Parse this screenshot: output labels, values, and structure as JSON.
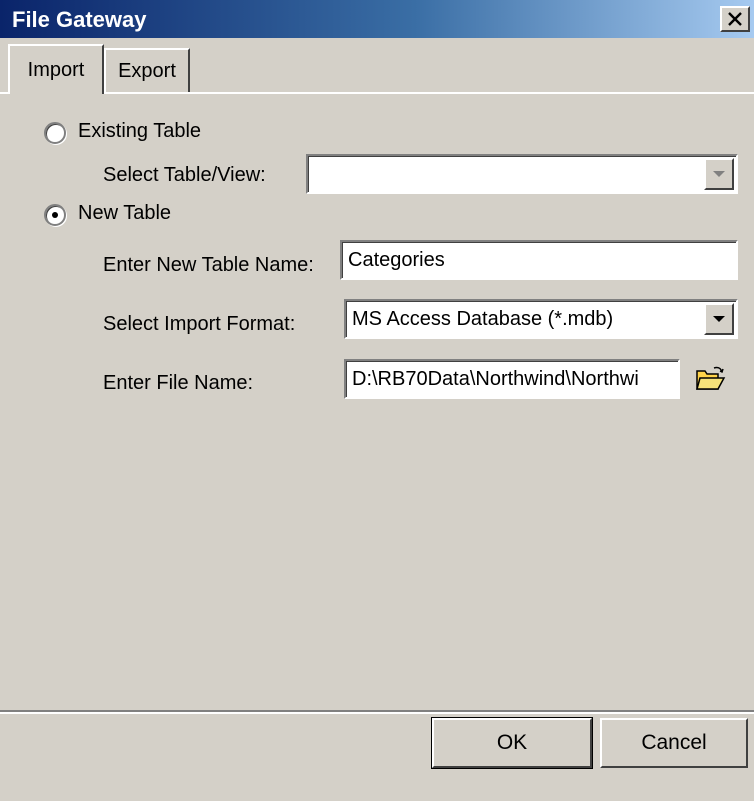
{
  "window": {
    "title": "File Gateway"
  },
  "tabs": [
    {
      "label": "Import",
      "active": true
    },
    {
      "label": "Export",
      "active": false
    }
  ],
  "import": {
    "existing_table": {
      "label": "Existing Table",
      "selected": false
    },
    "select_table_view": {
      "label": "Select Table/View:",
      "value": ""
    },
    "new_table": {
      "label": "New Table",
      "selected": true
    },
    "new_table_name": {
      "label": "Enter New Table Name:",
      "value": "Categories"
    },
    "import_format": {
      "label": "Select Import Format:",
      "value": "MS Access Database (*.mdb)"
    },
    "file_name": {
      "label": "Enter File Name:",
      "value": "D:\\RB70Data\\Northwind\\Northwi",
      "browse_icon": "open-folder-icon"
    }
  },
  "buttons": {
    "ok": "OK",
    "cancel": "Cancel"
  },
  "colors": {
    "titlebar_start": "#0a246a",
    "titlebar_end": "#a6caf0",
    "face": "#d4d0c8"
  }
}
